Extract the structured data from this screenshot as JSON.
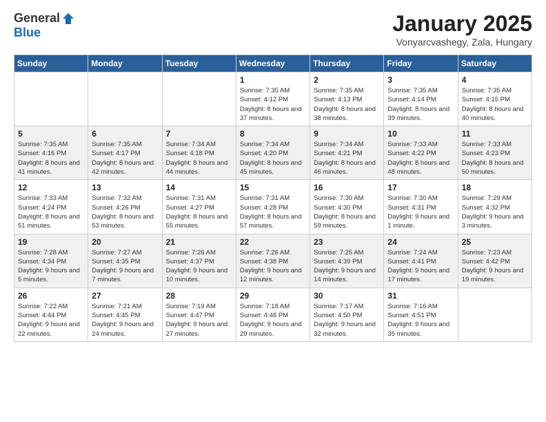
{
  "logo": {
    "general": "General",
    "blue": "Blue"
  },
  "header": {
    "title": "January 2025",
    "location": "Vonyarcvashegy, Zala, Hungary"
  },
  "weekdays": [
    "Sunday",
    "Monday",
    "Tuesday",
    "Wednesday",
    "Thursday",
    "Friday",
    "Saturday"
  ],
  "weeks": [
    [
      {
        "day": "",
        "info": ""
      },
      {
        "day": "",
        "info": ""
      },
      {
        "day": "",
        "info": ""
      },
      {
        "day": "1",
        "info": "Sunrise: 7:35 AM\nSunset: 4:12 PM\nDaylight: 8 hours and 37 minutes."
      },
      {
        "day": "2",
        "info": "Sunrise: 7:35 AM\nSunset: 4:13 PM\nDaylight: 8 hours and 38 minutes."
      },
      {
        "day": "3",
        "info": "Sunrise: 7:35 AM\nSunset: 4:14 PM\nDaylight: 8 hours and 39 minutes."
      },
      {
        "day": "4",
        "info": "Sunrise: 7:35 AM\nSunset: 4:15 PM\nDaylight: 8 hours and 40 minutes."
      }
    ],
    [
      {
        "day": "5",
        "info": "Sunrise: 7:35 AM\nSunset: 4:16 PM\nDaylight: 8 hours and 41 minutes."
      },
      {
        "day": "6",
        "info": "Sunrise: 7:35 AM\nSunset: 4:17 PM\nDaylight: 8 hours and 42 minutes."
      },
      {
        "day": "7",
        "info": "Sunrise: 7:34 AM\nSunset: 4:18 PM\nDaylight: 8 hours and 44 minutes."
      },
      {
        "day": "8",
        "info": "Sunrise: 7:34 AM\nSunset: 4:20 PM\nDaylight: 8 hours and 45 minutes."
      },
      {
        "day": "9",
        "info": "Sunrise: 7:34 AM\nSunset: 4:21 PM\nDaylight: 8 hours and 46 minutes."
      },
      {
        "day": "10",
        "info": "Sunrise: 7:33 AM\nSunset: 4:22 PM\nDaylight: 8 hours and 48 minutes."
      },
      {
        "day": "11",
        "info": "Sunrise: 7:33 AM\nSunset: 4:23 PM\nDaylight: 8 hours and 50 minutes."
      }
    ],
    [
      {
        "day": "12",
        "info": "Sunrise: 7:33 AM\nSunset: 4:24 PM\nDaylight: 8 hours and 51 minutes."
      },
      {
        "day": "13",
        "info": "Sunrise: 7:32 AM\nSunset: 4:26 PM\nDaylight: 8 hours and 53 minutes."
      },
      {
        "day": "14",
        "info": "Sunrise: 7:31 AM\nSunset: 4:27 PM\nDaylight: 8 hours and 55 minutes."
      },
      {
        "day": "15",
        "info": "Sunrise: 7:31 AM\nSunset: 4:28 PM\nDaylight: 8 hours and 57 minutes."
      },
      {
        "day": "16",
        "info": "Sunrise: 7:30 AM\nSunset: 4:30 PM\nDaylight: 8 hours and 59 minutes."
      },
      {
        "day": "17",
        "info": "Sunrise: 7:30 AM\nSunset: 4:31 PM\nDaylight: 9 hours and 1 minute."
      },
      {
        "day": "18",
        "info": "Sunrise: 7:29 AM\nSunset: 4:32 PM\nDaylight: 9 hours and 3 minutes."
      }
    ],
    [
      {
        "day": "19",
        "info": "Sunrise: 7:28 AM\nSunset: 4:34 PM\nDaylight: 9 hours and 5 minutes."
      },
      {
        "day": "20",
        "info": "Sunrise: 7:27 AM\nSunset: 4:35 PM\nDaylight: 9 hours and 7 minutes."
      },
      {
        "day": "21",
        "info": "Sunrise: 7:26 AM\nSunset: 4:37 PM\nDaylight: 9 hours and 10 minutes."
      },
      {
        "day": "22",
        "info": "Sunrise: 7:26 AM\nSunset: 4:38 PM\nDaylight: 9 hours and 12 minutes."
      },
      {
        "day": "23",
        "info": "Sunrise: 7:25 AM\nSunset: 4:39 PM\nDaylight: 9 hours and 14 minutes."
      },
      {
        "day": "24",
        "info": "Sunrise: 7:24 AM\nSunset: 4:41 PM\nDaylight: 9 hours and 17 minutes."
      },
      {
        "day": "25",
        "info": "Sunrise: 7:23 AM\nSunset: 4:42 PM\nDaylight: 9 hours and 19 minutes."
      }
    ],
    [
      {
        "day": "26",
        "info": "Sunrise: 7:22 AM\nSunset: 4:44 PM\nDaylight: 9 hours and 22 minutes."
      },
      {
        "day": "27",
        "info": "Sunrise: 7:21 AM\nSunset: 4:45 PM\nDaylight: 9 hours and 24 minutes."
      },
      {
        "day": "28",
        "info": "Sunrise: 7:19 AM\nSunset: 4:47 PM\nDaylight: 9 hours and 27 minutes."
      },
      {
        "day": "29",
        "info": "Sunrise: 7:18 AM\nSunset: 4:48 PM\nDaylight: 9 hours and 29 minutes."
      },
      {
        "day": "30",
        "info": "Sunrise: 7:17 AM\nSunset: 4:50 PM\nDaylight: 9 hours and 32 minutes."
      },
      {
        "day": "31",
        "info": "Sunrise: 7:16 AM\nSunset: 4:51 PM\nDaylight: 9 hours and 35 minutes."
      },
      {
        "day": "",
        "info": ""
      }
    ]
  ]
}
